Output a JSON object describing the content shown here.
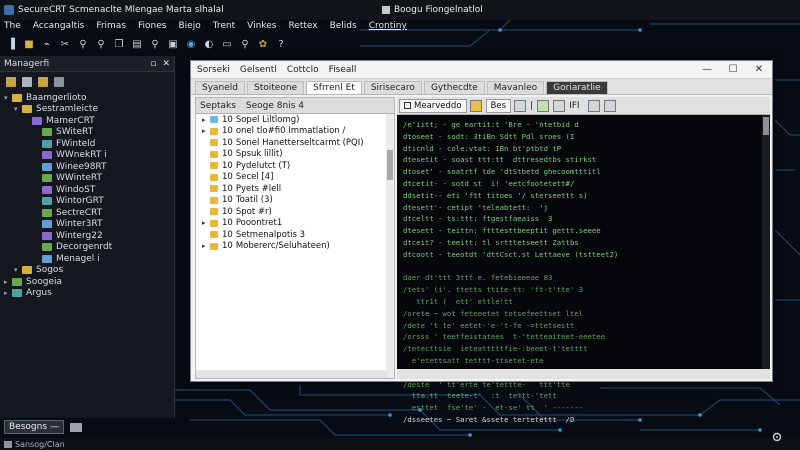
{
  "app": {
    "title": "SecureCRT Scmenaclte Mlengae Marta slhalal",
    "secondary_title": "Boogu Fiongelnatlol"
  },
  "menu": [
    "The",
    "Accangaltis",
    "Frimas",
    "Fiones",
    "Biejo",
    "Trent",
    "Vinkes",
    "Rettex",
    "Belids",
    "Crontiny"
  ],
  "session_manager": {
    "header": "Managerfi",
    "tree": [
      {
        "label": "Baamgerlioto",
        "level": 0,
        "icon": "folder"
      },
      {
        "label": "Sestramleicte",
        "level": 1,
        "icon": "folder"
      },
      {
        "label": "MamerCRT",
        "level": 2,
        "icon": "session"
      },
      {
        "label": "SWiteRT",
        "level": 3,
        "icon": "session"
      },
      {
        "label": "FWinteld",
        "level": 3,
        "icon": "session"
      },
      {
        "label": "WWnekRT i",
        "level": 3,
        "icon": "session"
      },
      {
        "label": "Winee98RT",
        "level": 3,
        "icon": "session"
      },
      {
        "label": "WWinteRT",
        "level": 3,
        "icon": "session"
      },
      {
        "label": "WindoST",
        "level": 3,
        "icon": "session"
      },
      {
        "label": "WintorGRT",
        "level": 3,
        "icon": "session"
      },
      {
        "label": "SectreCRT",
        "level": 3,
        "icon": "session"
      },
      {
        "label": "Winter3RT",
        "level": 3,
        "icon": "session"
      },
      {
        "label": "Winterg22",
        "level": 3,
        "icon": "session"
      },
      {
        "label": "Decorgenrdt",
        "level": 3,
        "icon": "session"
      },
      {
        "label": "Menagel i",
        "level": 3,
        "icon": "session"
      },
      {
        "label": "Sogos",
        "level": 1,
        "icon": "folder"
      },
      {
        "label": "Soogeia",
        "level": 0,
        "icon": "session"
      },
      {
        "label": "Argus",
        "level": 0,
        "icon": "session"
      }
    ],
    "bottom_tab": "Besogns —"
  },
  "status": "Sansog/Clan",
  "window": {
    "title_items": [
      "Sorseki",
      "Gelsentl",
      "Cottclo",
      "Fiseall"
    ],
    "tabs": [
      "Syaneld",
      "Stoiteone",
      "Sfrrenl Et",
      "Sirisecaro",
      "Gythecdte",
      "Mavanleo",
      "Goriaratlie"
    ],
    "left_pane": {
      "head": [
        "Septaks",
        "Seoge 8nis 4"
      ],
      "rows": [
        {
          "prefix": "10",
          "label": "Sopel Liltlomg)"
        },
        {
          "prefix": "10",
          "label": "onel tlo#fi0 Immatlation /"
        },
        {
          "prefix": "10",
          "label": "Sonel Hanetterseltcarmt (PQI)"
        },
        {
          "prefix": "10",
          "label": "Spsuk lillit)"
        },
        {
          "prefix": "10",
          "label": "Pydelutct (T)"
        },
        {
          "prefix": "10",
          "label": "Secel [4]"
        },
        {
          "prefix": "10",
          "label": "Pyets #lell"
        },
        {
          "prefix": "10",
          "label": "Toatil (3)"
        },
        {
          "prefix": "10",
          "label": "Spot #r)"
        },
        {
          "prefix": "10",
          "label": "Pooontret1"
        },
        {
          "prefix": "10",
          "label": "Setmenalpotis 3"
        },
        {
          "prefix": "10",
          "label": "Mobererc/Seluhateen)"
        }
      ]
    },
    "right_toolbar": {
      "button": "Mearveddo",
      "button2": "Bes",
      "marker": "IFI"
    },
    "terminal_lines": [
      {
        "t": "/e'iitt; - ge eartit:t 'Bre - 'ntetbid d",
        "c": "green"
      },
      {
        "t": "dtoseet - sodt: 3tiBn Sdtt Pdl sroes (I",
        "c": "green"
      },
      {
        "t": "dticnld - cole:vtat: 1Bn bt'ptbtd tP",
        "c": "green"
      },
      {
        "t": "dtesetit - soast ttt:tt  dttresedtbs stirkst",
        "c": "green"
      },
      {
        "t": "dtoset' - soatrtf tde 'dtStbetd ghecoomtttitl",
        "c": "green"
      },
      {
        "t": "dtcetit- - sotd st  i! 'eetcfootetett#/",
        "c": "green"
      },
      {
        "t": "ddsetit-- eti 'ftt titoes '/ sterseettt s)",
        "c": "green"
      },
      {
        "t": "dtesett'- cetipt 'teleabtett:  'j",
        "c": "green"
      },
      {
        "t": "dtceltt - ts:ttt: ftgestfaeaiss  3",
        "c": "green"
      },
      {
        "t": "dtesett - teittn: ftttesttbeeptit gettt.seeee",
        "c": "green"
      },
      {
        "t": "dtceit? - teeitt: tl srtttetseett Zattbs",
        "c": "green"
      },
      {
        "t": "dtcoott - teeotdt 'dttCsct.st Lettaeve (tstteet2)",
        "c": "green"
      },
      {
        "t": "",
        "c": "green"
      },
      {
        "t": "daer dt'ttt 3ttf e. fetebieeeae 83",
        "c": "dim"
      },
      {
        "t": "/tets' (i'. ttetts ttite-tt: 'ft-t'tte' 3",
        "c": "dim"
      },
      {
        "t": "   ttr1t (  ett' ettle!tt",
        "c": "dim"
      },
      {
        "t": "/orete ~ wot feteeetet totsefeettset ltel",
        "c": "dim"
      },
      {
        "t": "/dete 't te' eetet-'e-'t-fe -=ttetsestt",
        "c": "dim"
      },
      {
        "t": "/orsss ' teetfeistatees  t-'tetteaiteet-eeetee",
        "c": "dim"
      },
      {
        "t": "/tetecttsie  ieteatttttfie-:beeet-t'tetttt",
        "c": "dim"
      },
      {
        "t": "  e'etettsatt tetttt-ttsetet-ete",
        "c": "dim"
      },
      {
        "t": "",
        "c": "green"
      },
      {
        "t": "/deste  ' tt'erte te'tettte-   ttt'tte",
        "c": "dim"
      },
      {
        "t": "  tta.tt  teete-t'  :t  tettt-'tett",
        "c": "dim"
      },
      {
        "t": "  esttet  fse'te' -  et-se' tt  ' -------",
        "c": "dim"
      },
      {
        "t": "/dsseetes ~ Saret &ssete tertetettt  /D",
        "c": "white"
      }
    ]
  }
}
